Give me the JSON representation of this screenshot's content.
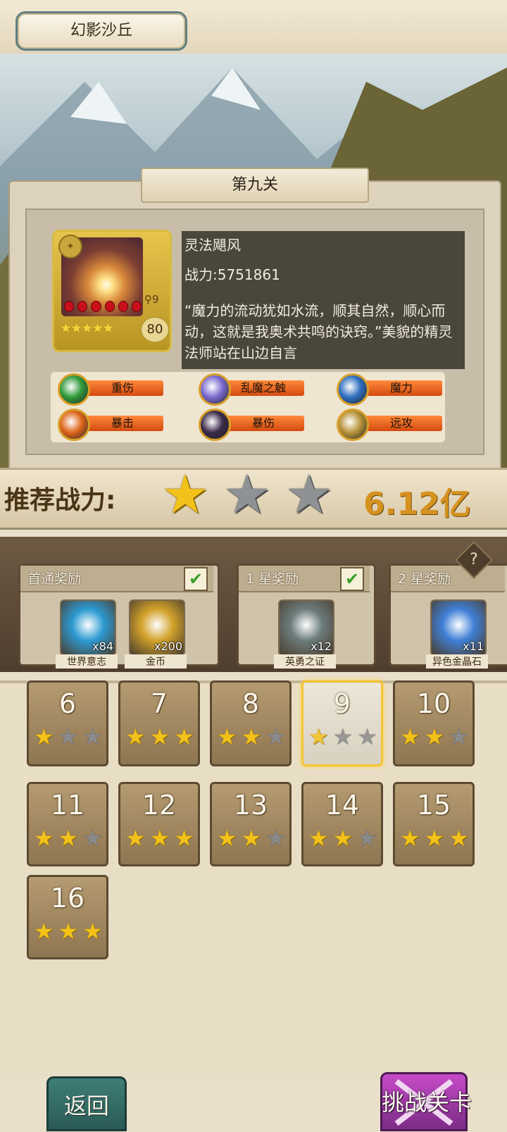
{
  "header": {
    "area_title": "幻影沙丘"
  },
  "stage": {
    "name": "第九关",
    "enemy": {
      "name": "灵法飓风",
      "power": "战力:5751861",
      "description": "“魔力的流动犹如水流，顺其自然，顺心而动，这就是我奥术共鸣的诀窍。”美貌的精灵法师站在山边自言",
      "level": "80",
      "rank": "9",
      "stars": 5,
      "orbs": 6
    },
    "traits": [
      {
        "label": "重伤",
        "icon": "green-slash-icon",
        "color": "#2f9a3a"
      },
      {
        "label": "乱魔之触",
        "icon": "purple-magic-icon",
        "color": "#7b6ad0"
      },
      {
        "label": "魔力",
        "icon": "blue-book-icon",
        "color": "#2f6fc0"
      },
      {
        "label": "暴击",
        "icon": "fire-burst-icon",
        "color": "#e0651a"
      },
      {
        "label": "暴伤",
        "icon": "dark-demon-icon",
        "color": "#3b2a4a"
      },
      {
        "label": "远攻",
        "icon": "bow-icon",
        "color": "#b8943a"
      }
    ]
  },
  "recommend": {
    "label": "推荐战力:",
    "value": "6.12亿",
    "stars_earned": 1,
    "stars_total": 3
  },
  "rewards": [
    {
      "title": "首通奖励",
      "claimed": true,
      "items": [
        {
          "name": "世界意志",
          "count": "x84",
          "icon": "blue-crystal-lantern-icon",
          "color": "#2c9ad2"
        },
        {
          "name": "金币",
          "count": "x200",
          "icon": "gold-coin-icon",
          "color": "#d2a22a"
        }
      ]
    },
    {
      "title": "1 星奖励",
      "claimed": true,
      "items": [
        {
          "name": "英勇之证",
          "count": "x12",
          "icon": "sword-hilt-icon",
          "color": "#6c7c7c"
        }
      ]
    },
    {
      "title": "2 星奖励",
      "claimed": false,
      "items": [
        {
          "name": "异色金晶石",
          "count": "x11",
          "icon": "blue-gem-icon",
          "color": "#3f7fd6"
        }
      ]
    }
  ],
  "help_label": "?",
  "stages": [
    {
      "num": "6",
      "stars": 1
    },
    {
      "num": "7",
      "stars": 3
    },
    {
      "num": "8",
      "stars": 2
    },
    {
      "num": "9",
      "stars": 1,
      "selected": true
    },
    {
      "num": "10",
      "stars": 2
    },
    {
      "num": "11",
      "stars": 2
    },
    {
      "num": "12",
      "stars": 3
    },
    {
      "num": "13",
      "stars": 2
    },
    {
      "num": "14",
      "stars": 2
    },
    {
      "num": "15",
      "stars": 3
    },
    {
      "num": "16",
      "stars": 3
    }
  ],
  "footer": {
    "back_label": "返回",
    "challenge_label": "挑战关卡"
  }
}
